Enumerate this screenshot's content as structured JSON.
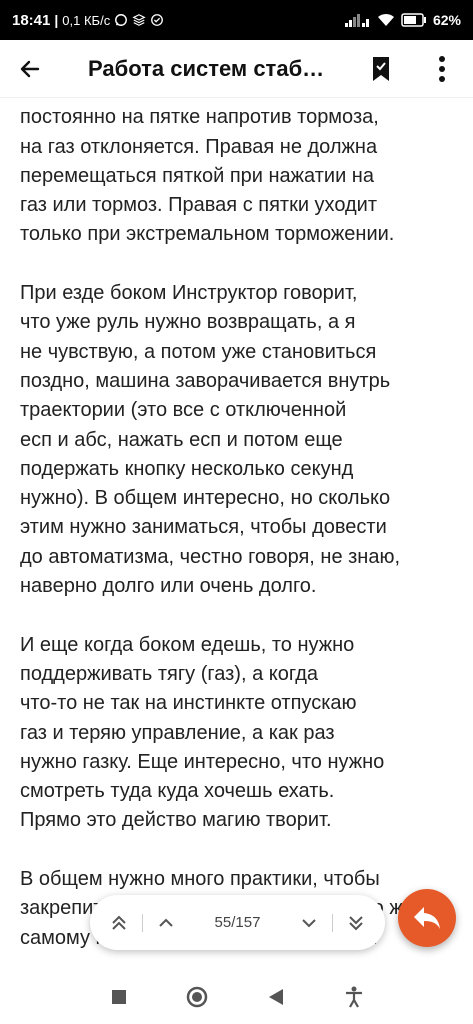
{
  "status_bar": {
    "time": "18:41",
    "speed": "0,1 КБ/с",
    "battery": "62"
  },
  "header": {
    "title": "Работа систем стаб…"
  },
  "article": {
    "paragraphs": [
      "должна туда возвращаться. Правая\nпостоянно на пятке напротив тормоза,\nна газ отклоняется. Правая не должна\nперемещаться пяткой при нажатии на\nгаз или тормоз. Правая с пятки уходит\nтолько при экстремальном торможении.",
      "При езде боком Инструктор говорит,\nчто уже руль нужно возвращать, а я\nне чувствую, а потом уже становиться\nпоздно, машина заворачивается внутрь\nтраектории (это все с отключенной\nесп и абс, нажать есп и потом еще\nподержать кнопку несколько секунд\nнужно). В общем интересно, но сколько\nэтим нужно заниматься, чтобы довести\nдо автоматизма, честно говоря, не знаю,\nнаверно долго или очень долго.",
      "И еще когда боком едешь, то нужно\nподдерживать тягу (газ), а когда\nчто-то не так на инстинкте отпускаю\nгаз и теряю управление, а как раз\nнужно газку. Еще интересно, что нужно\nсмотреть туда куда хочешь ехать.\nПрямо это действо магию творит.",
      "В общем нужно много практики, чтобы\nзакрепить навыки, и ездить в одно и то же\nсамому месте искать и пробовать. Вот"
    ]
  },
  "pager": {
    "page_indicator": "55/157"
  },
  "colors": {
    "accent": "#e65a2a",
    "text": "#222222",
    "statusbar": "#000000"
  }
}
